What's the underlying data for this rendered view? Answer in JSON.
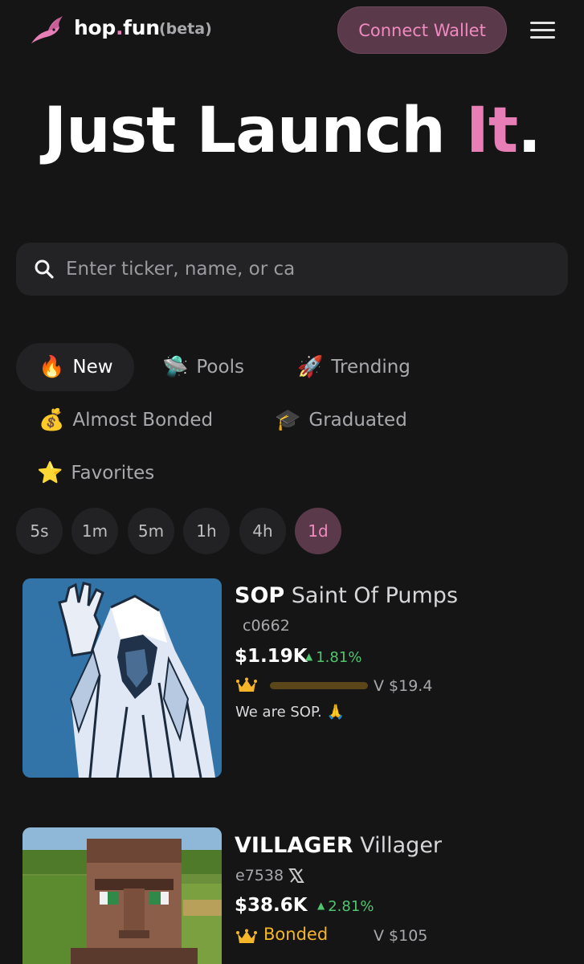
{
  "header": {
    "brand_name": "hop",
    "brand_dot": ".",
    "brand_tld": "fun",
    "beta_label": "(beta)",
    "connect_label": "Connect Wallet",
    "accent_color": "#e77fb6"
  },
  "hero": {
    "part1": "Just Launch ",
    "accent": "It",
    "end": "."
  },
  "search": {
    "placeholder": "Enter ticker, name, or ca"
  },
  "tabs": [
    {
      "emoji": "🔥",
      "label": "New",
      "icon": "fire-icon",
      "active": true
    },
    {
      "emoji": "🛸",
      "label": "Pools",
      "icon": "ufo-icon",
      "active": false
    },
    {
      "emoji": "🚀",
      "label": "Trending",
      "icon": "rocket-icon",
      "active": false
    },
    {
      "emoji": "💰",
      "label": "Almost Bonded",
      "icon": "money-bag-icon",
      "active": false
    },
    {
      "emoji": "🎓",
      "label": "Graduated",
      "icon": "graduation-cap-icon",
      "active": false
    },
    {
      "emoji": "⭐",
      "label": "Favorites",
      "icon": "star-icon",
      "active": false
    }
  ],
  "timeframes": [
    {
      "label": "5s",
      "active": false
    },
    {
      "label": "1m",
      "active": false
    },
    {
      "label": "5m",
      "active": false
    },
    {
      "label": "1h",
      "active": false
    },
    {
      "label": "4h",
      "active": false
    },
    {
      "label": "1d",
      "active": true
    }
  ],
  "tokens": [
    {
      "ticker": "SOP",
      "name": "Saint Of Pumps",
      "address": "c0662",
      "market_cap": "$1.19K",
      "change": "1.81%",
      "change_color": "#4fc66f",
      "volume": "V $19.4",
      "bonding_progress": 0,
      "description": "We are SOP. 🙏"
    },
    {
      "ticker": "VILLAGER",
      "name": "Villager",
      "address": "e7538",
      "market_cap": "$38.6K",
      "change": "2.81%",
      "change_color": "#4fc66f",
      "status": "Bonded",
      "status_color": "#f5b528",
      "volume": "V $105"
    }
  ]
}
